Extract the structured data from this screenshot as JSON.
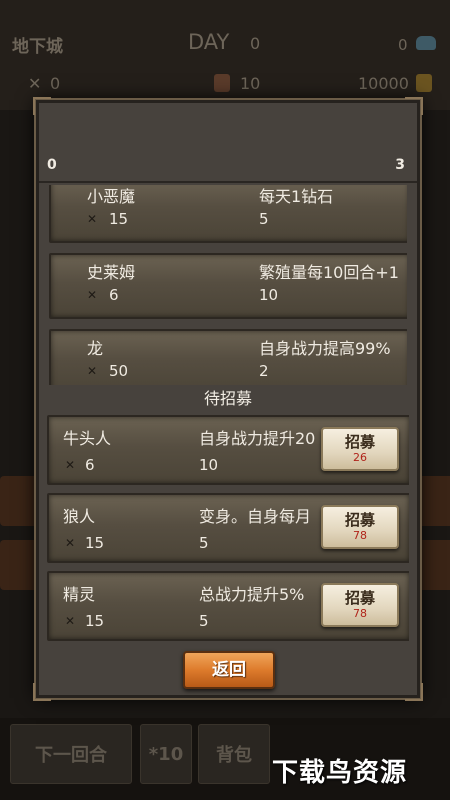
{
  "background": {
    "title": "地下城",
    "day_label": "DAY",
    "day_value": "0",
    "diamonds": "0",
    "level_stat": "0",
    "population": "10",
    "gold": "10000",
    "buttons": [
      "下一回合",
      "*10",
      "背包"
    ]
  },
  "dialog": {
    "count_left": "0",
    "count_right": "3",
    "owned": [
      {
        "name": "小恶魔",
        "level": "15",
        "desc": "每天1钻石",
        "value": "5"
      },
      {
        "name": "史莱姆",
        "level": "6",
        "desc": "繁殖量每10回合+1",
        "value": "10"
      },
      {
        "name": "龙",
        "level": "50",
        "desc": "自身战力提高99%",
        "value": "2"
      }
    ],
    "section_title": "待招募",
    "to_recruit": [
      {
        "name": "牛头人",
        "level": "6",
        "desc": "自身战力提升20",
        "value": "10",
        "btn_label": "招募",
        "cost": "26"
      },
      {
        "name": "狼人",
        "level": "15",
        "desc": "变身。自身每月",
        "value": "5",
        "btn_label": "招募",
        "cost": "78"
      },
      {
        "name": "精灵",
        "level": "15",
        "desc": "总战力提升5%",
        "value": "5",
        "btn_label": "招募",
        "cost": "78"
      }
    ],
    "back_label": "返回"
  },
  "watermark": "下载鸟资源",
  "colors": {
    "panel": "#47423d",
    "card": "#564e41",
    "back_button": "#dd7b2c",
    "cost_text": "#b0241a"
  },
  "icons": {
    "level": "crossed-swords-icon",
    "population": "hourglass-icon",
    "gold": "gold-bars-icon",
    "diamond": "diamond-icon"
  }
}
